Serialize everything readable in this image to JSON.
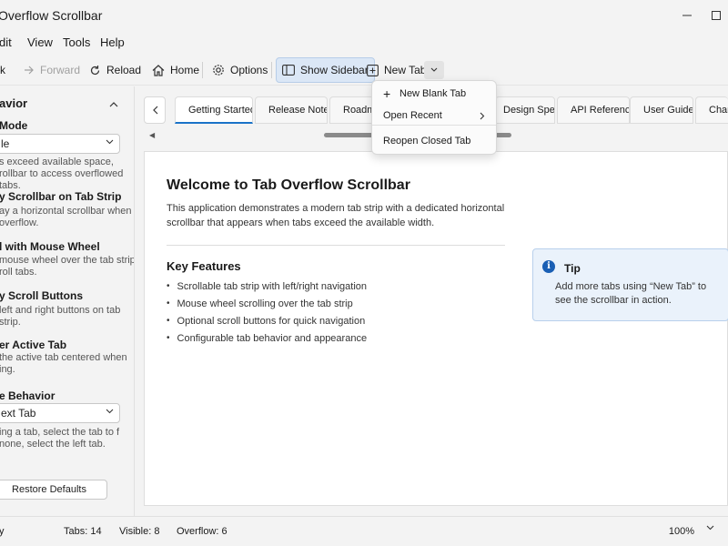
{
  "window": {
    "title": "Overflow Scrollbar"
  },
  "menu": {
    "items": [
      "dit",
      "View",
      "Tools",
      "Help"
    ]
  },
  "toolbar": {
    "back": "k",
    "forward": "Forward",
    "reload": "Reload",
    "home": "Home",
    "options": "Options",
    "show_sidebar": "Show Sidebar",
    "new_tab": "New Tab"
  },
  "sidebar": {
    "header": "avior",
    "mode_label": "Mode",
    "mode_value": "le",
    "mode_desc": "s exceed available space, rollbar to access overflowed tabs.",
    "scrollbar_label": "y Scrollbar on Tab Strip",
    "scrollbar_desc": "ay a horizontal scrollbar when overflow.",
    "wheel_label": "l with Mouse Wheel",
    "wheel_desc": "mouse wheel over the tab strip roll tabs.",
    "buttons_label": "y Scroll Buttons",
    "buttons_desc": "left and right buttons on tab strip.",
    "center_label": "er Active Tab",
    "center_desc": "the active tab centered when ing.",
    "close_label": "e Behavior",
    "close_value": "ext Tab",
    "close_desc": "ing a tab, select the tab to f none, select the left tab.",
    "restore": "Restore Defaults"
  },
  "tabs": [
    {
      "label": "Getting Started",
      "selected": true,
      "icon": "document-icon"
    },
    {
      "label": "Release Notes",
      "selected": false,
      "icon": "notes-icon"
    },
    {
      "label": "Roadm",
      "selected": false,
      "icon": "excel-icon"
    },
    {
      "label": "Design Specs",
      "selected": false,
      "icon": "document-icon"
    },
    {
      "label": "API Reference",
      "selected": false,
      "icon": "document-icon"
    },
    {
      "label": "User Guide",
      "selected": false,
      "icon": "document-icon"
    },
    {
      "label": "Chan",
      "selected": false,
      "icon": "document-icon"
    }
  ],
  "dropdown": {
    "new_blank": "New Blank Tab",
    "open_recent": "Open Recent",
    "reopen_closed": "Reopen Closed Tab"
  },
  "page": {
    "title": "Welcome to Tab Overflow Scrollbar",
    "intro": "This application demonstrates a modern tab strip with a dedicated horizontal scrollbar that appears when tabs exceed the available width.",
    "features_heading": "Key Features",
    "features": [
      "Scrollable tab strip with left/right navigation",
      "Mouse wheel scrolling over the tab strip",
      "Optional scroll buttons for quick navigation",
      "Configurable tab behavior and appearance"
    ]
  },
  "tip": {
    "title": "Tip",
    "text": "Add more tabs using “New Tab” to see the scrollbar in action."
  },
  "status": {
    "ready": "y",
    "tabs": "Tabs: 14",
    "visible": "Visible: 8",
    "overflow": "Overflow: 6",
    "zoom": "100%"
  },
  "colors": {
    "accent": "#1a73c8",
    "tip_bg": "#eaf2fb",
    "excel": "#1f7a3f"
  }
}
